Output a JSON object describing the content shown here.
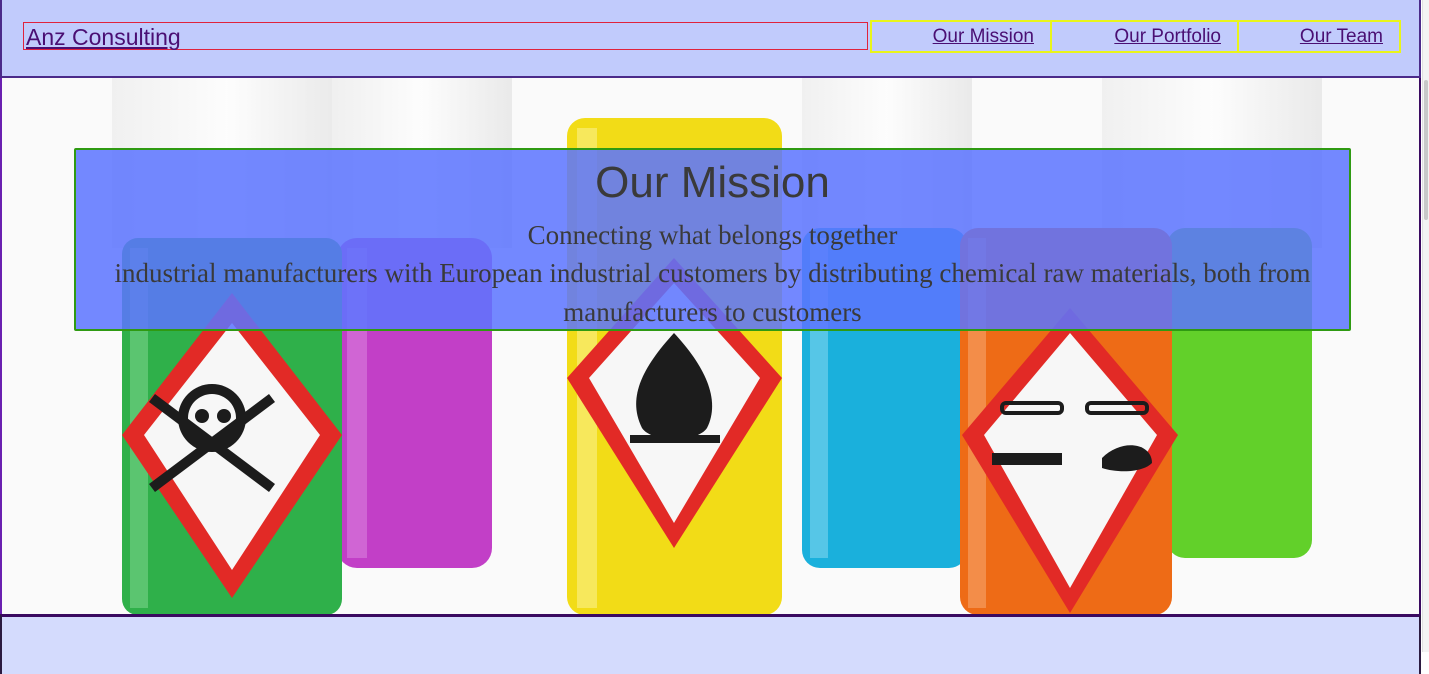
{
  "header": {
    "brand": "Anz Consulting",
    "nav": [
      {
        "label": "Our Mission"
      },
      {
        "label": "Our Portfolio"
      },
      {
        "label": "Our Team"
      }
    ]
  },
  "hero": {
    "image_alt": "Chemical bottles with hazard symbols",
    "mission": {
      "title": "Our Mission",
      "tagline": "Connecting what belongs together",
      "description": "industrial manufacturers with European industrial customers by distributing chemical raw materials, both from manufacturers to customers"
    }
  },
  "colors": {
    "header_bg": "#c1cbfc",
    "link": "#4a0f73",
    "mission_bg": "#5c74ff",
    "mission_border": "#2f9a12",
    "nav_border": "#e9f51a",
    "brand_border": "#e0223c"
  }
}
